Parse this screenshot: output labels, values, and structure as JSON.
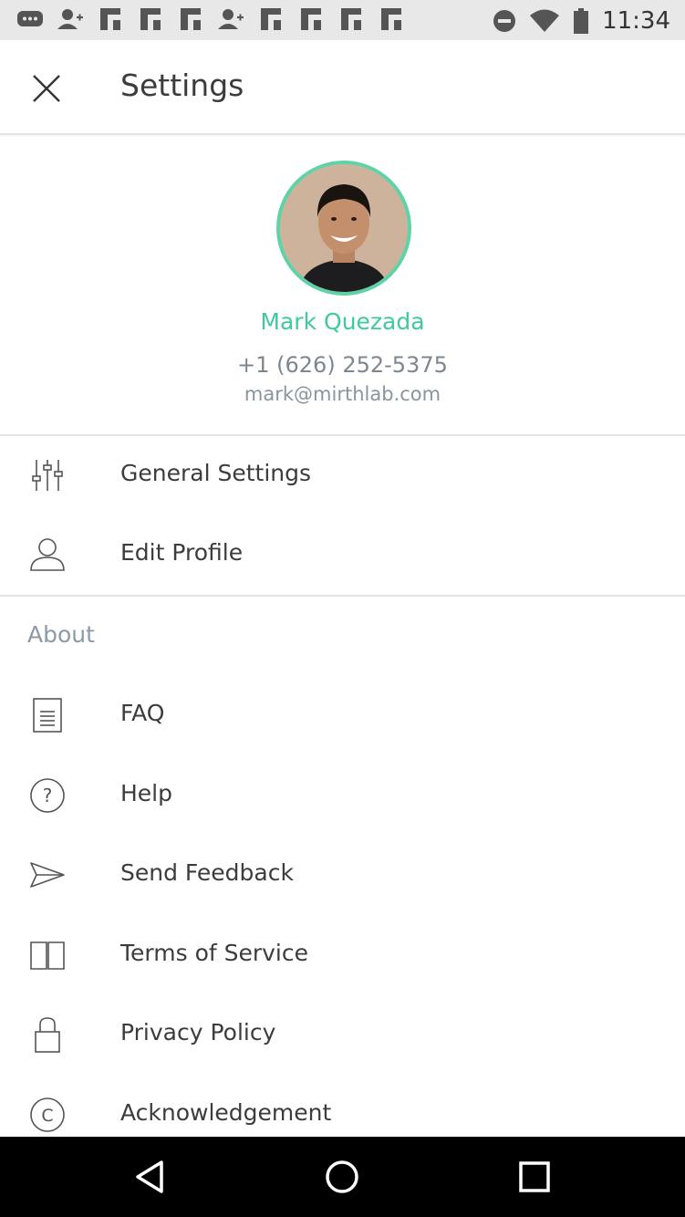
{
  "status_bar": {
    "time": "11:34",
    "left_icons": [
      "messages-icon",
      "add-person-icon",
      "flipboard-icon",
      "flipboard-icon",
      "flipboard-icon",
      "add-person-icon",
      "flipboard-icon",
      "flipboard-icon",
      "flipboard-icon",
      "flipboard-icon"
    ],
    "right_icons": [
      "do-not-disturb-icon",
      "wifi-icon",
      "battery-icon"
    ]
  },
  "header": {
    "title": "Settings",
    "close_icon": "close-icon"
  },
  "profile": {
    "name": "Mark Quezada",
    "phone": "+1 (626) 252-5375",
    "email": "mark@mirthlab.com",
    "accent_color": "#3ec9a1"
  },
  "menu": {
    "items": [
      {
        "label": "General Settings",
        "icon": "sliders-icon"
      },
      {
        "label": "Edit Profile",
        "icon": "user-icon"
      }
    ]
  },
  "about": {
    "title": "About",
    "items": [
      {
        "label": "FAQ",
        "icon": "document-icon"
      },
      {
        "label": "Help",
        "icon": "help-icon"
      },
      {
        "label": "Send Feedback",
        "icon": "send-icon"
      },
      {
        "label": "Terms of Service",
        "icon": "book-icon"
      },
      {
        "label": "Privacy Policy",
        "icon": "lock-icon"
      },
      {
        "label": "Acknowledgement",
        "icon": "copyright-icon"
      }
    ]
  },
  "nav_bar": {
    "buttons": [
      "back-icon",
      "home-icon",
      "recents-icon"
    ]
  }
}
